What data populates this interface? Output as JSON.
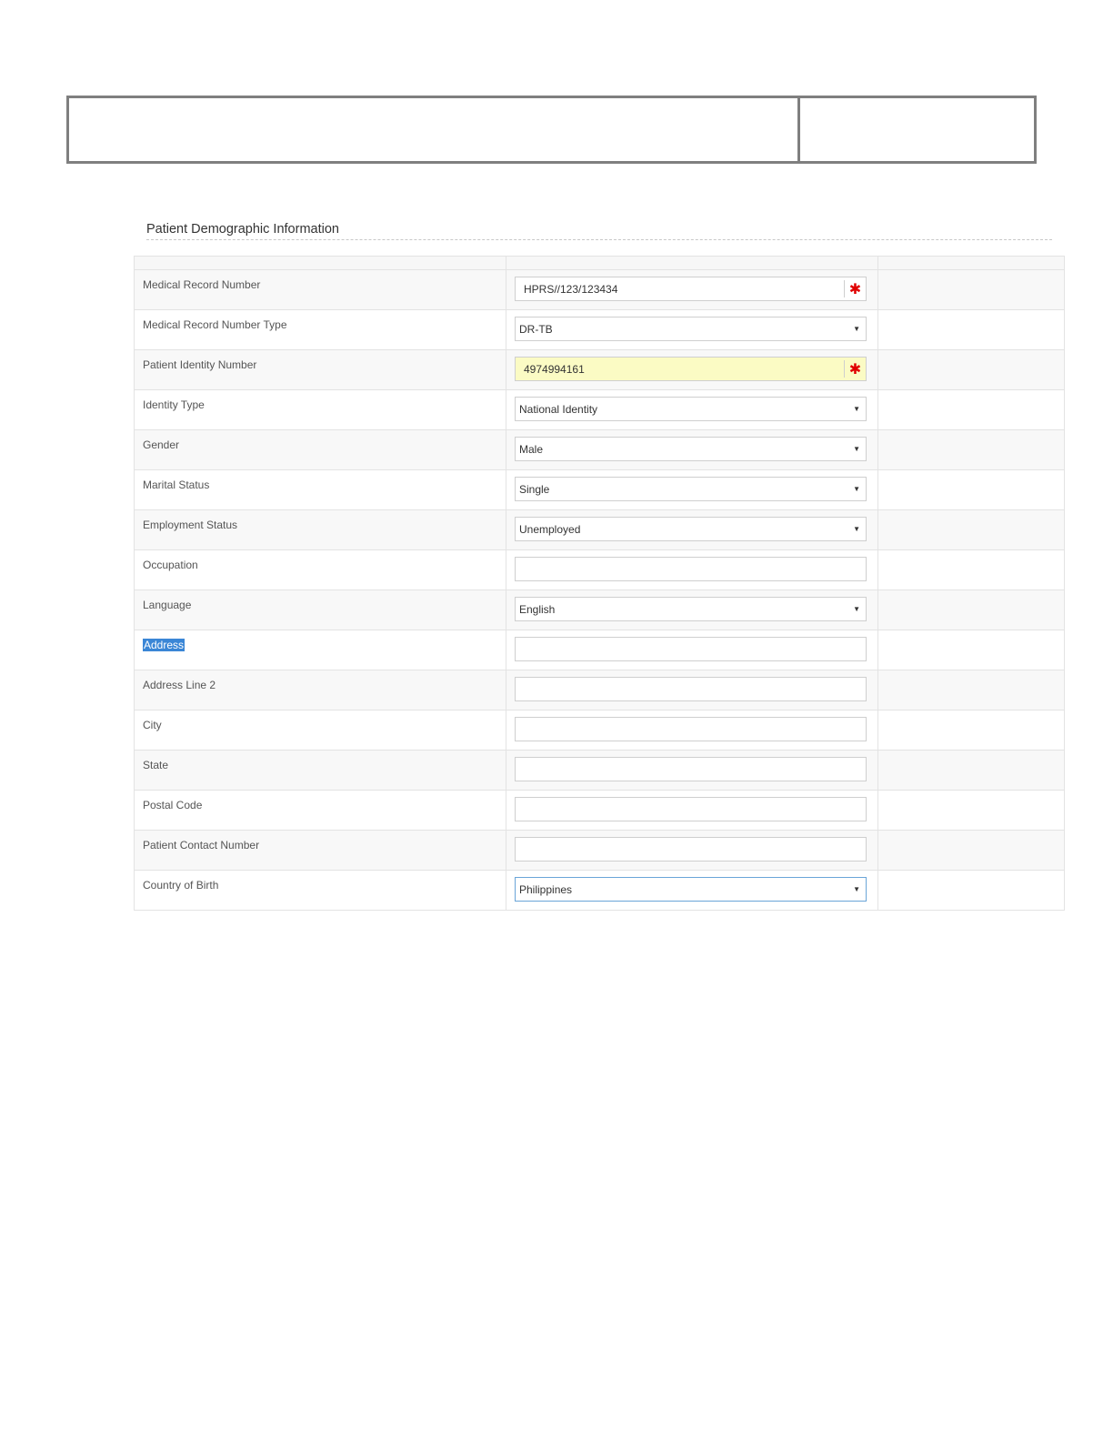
{
  "section": {
    "title": "Patient Demographic Information"
  },
  "fields": [
    {
      "label": "Medical Record Number",
      "type": "text",
      "value": "HPRS//123/123434",
      "required": true
    },
    {
      "label": "Medical Record Number Type",
      "type": "select",
      "value": "DR-TB"
    },
    {
      "label": "Patient Identity Number",
      "type": "text",
      "value": "4974994161",
      "required": true,
      "highlight": true
    },
    {
      "label": "Identity Type",
      "type": "select",
      "value": "National Identity"
    },
    {
      "label": "Gender",
      "type": "select",
      "value": "Male"
    },
    {
      "label": "Marital Status",
      "type": "select",
      "value": "Single"
    },
    {
      "label": "Employment Status",
      "type": "select",
      "value": "Unemployed"
    },
    {
      "label": "Occupation",
      "type": "text",
      "value": ""
    },
    {
      "label": "Language",
      "type": "select",
      "value": "English"
    },
    {
      "label": "Address",
      "type": "text",
      "value": "",
      "label_selected": true
    },
    {
      "label": "Address Line 2",
      "type": "text",
      "value": ""
    },
    {
      "label": "City",
      "type": "text",
      "value": ""
    },
    {
      "label": "State",
      "type": "text",
      "value": ""
    },
    {
      "label": "Postal Code",
      "type": "text",
      "value": ""
    },
    {
      "label": "Patient Contact Number",
      "type": "text",
      "value": ""
    },
    {
      "label": "Country of Birth",
      "type": "select",
      "value": "Philippines",
      "focused": true
    }
  ],
  "icons": {
    "required": "asterisk-icon",
    "dropdown": "caret-down-icon"
  },
  "colors": {
    "required": "#e00000",
    "highlight": "#fbfbc4",
    "selection": "#3a86d6",
    "focus": "#6aa5d8"
  }
}
